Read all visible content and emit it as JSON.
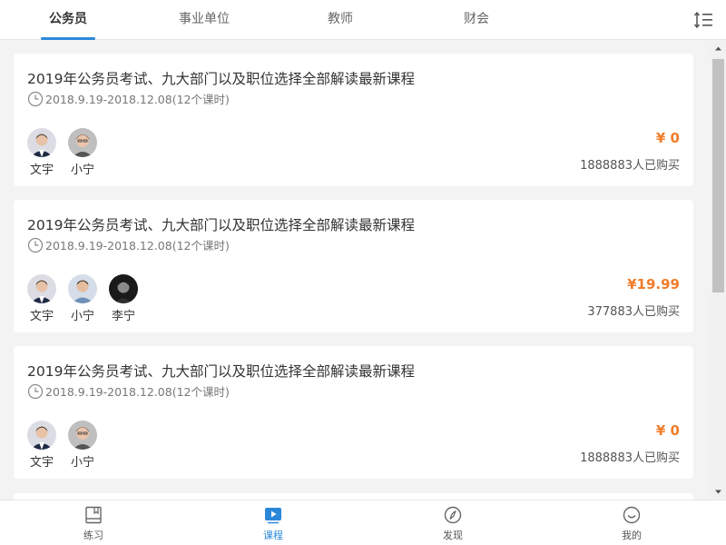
{
  "tabs": [
    {
      "label": "公务员",
      "active": true
    },
    {
      "label": "事业单位",
      "active": false
    },
    {
      "label": "教师",
      "active": false
    },
    {
      "label": "财会",
      "active": false
    }
  ],
  "sort_icon": "sort-list-icon",
  "courses": [
    {
      "title": "2019年公务员考试、九大部门以及职位选择全部解读最新课程",
      "time": "2018.9.19-2018.12.08(12个课时)",
      "teachers": [
        {
          "name": "文宇"
        },
        {
          "name": "小宁"
        }
      ],
      "price": "¥ 0",
      "buyers": "1888883人已购买"
    },
    {
      "title": "2019年公务员考试、九大部门以及职位选择全部解读最新课程",
      "time": "2018.9.19-2018.12.08(12个课时)",
      "teachers": [
        {
          "name": "文宇"
        },
        {
          "name": "小宁"
        },
        {
          "name": "李宁"
        }
      ],
      "price": "¥19.99",
      "buyers": "377883人已购买"
    },
    {
      "title": "2019年公务员考试、九大部门以及职位选择全部解读最新课程",
      "time": "2018.9.19-2018.12.08(12个课时)",
      "teachers": [
        {
          "name": "文宇"
        },
        {
          "name": "小宁"
        }
      ],
      "price": "¥ 0",
      "buyers": "1888883人已购买"
    }
  ],
  "bottom_nav": [
    {
      "label": "练习",
      "icon": "book-icon",
      "active": false
    },
    {
      "label": "课程",
      "icon": "play-icon",
      "active": true
    },
    {
      "label": "发现",
      "icon": "compass-icon",
      "active": false
    },
    {
      "label": "我的",
      "icon": "smile-icon",
      "active": false
    }
  ],
  "colors": {
    "accent": "#2b88d8",
    "price": "#f07d2b",
    "background": "#f3f3f3"
  }
}
